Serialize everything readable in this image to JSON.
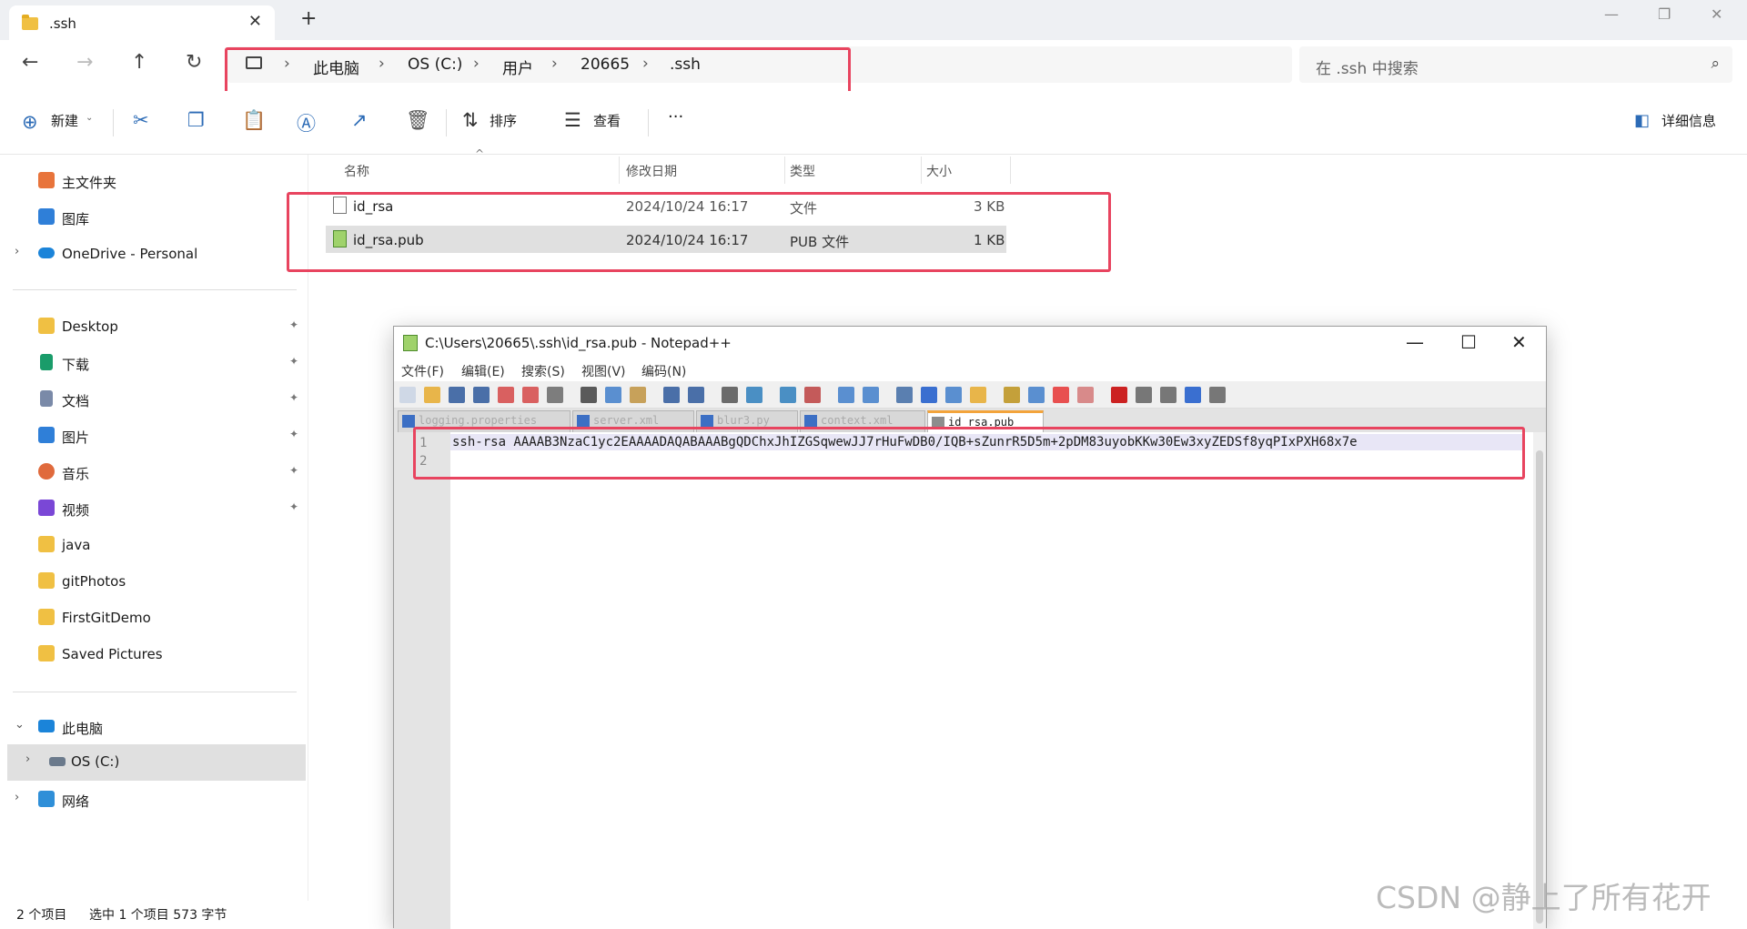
{
  "explorer": {
    "tab_title": ".ssh",
    "tab_close": "✕",
    "new_tab": "+",
    "window_buttons": {
      "minimize": "—",
      "maximize": "❐",
      "close": "✕"
    },
    "nav": {
      "back": "←",
      "forward": "→",
      "up": "↑",
      "refresh": "↻"
    },
    "breadcrumb": [
      "此电脑",
      "OS (C:)",
      "用户",
      "20665",
      ".ssh"
    ],
    "breadcrumb_sep": "›",
    "search_placeholder": "在 .ssh 中搜索",
    "toolbar": {
      "new_label": "新建",
      "sort_label": "排序",
      "view_label": "查看",
      "more_label": "···",
      "details_label": "详细信息"
    },
    "sidebar": {
      "quick": [
        {
          "label": "主文件夹",
          "icon": "home-icon",
          "color": "#e8743b"
        },
        {
          "label": "图库",
          "icon": "gallery-icon",
          "color": "#2f7fd8"
        },
        {
          "label": "OneDrive - Personal",
          "icon": "onedrive-icon",
          "color": "#1b84d9"
        }
      ],
      "pinned": [
        {
          "label": "Desktop",
          "icon": "folder-icon",
          "color": "#f0c043",
          "pinned": true
        },
        {
          "label": "下载",
          "icon": "download-icon",
          "color": "#1a9c6a",
          "pinned": true
        },
        {
          "label": "文档",
          "icon": "documents-icon",
          "color": "#7a8aa8",
          "pinned": true
        },
        {
          "label": "图片",
          "icon": "pictures-icon",
          "color": "#2f7fd8",
          "pinned": true
        },
        {
          "label": "音乐",
          "icon": "music-icon",
          "color": "#e06a3c",
          "pinned": true
        },
        {
          "label": "视频",
          "icon": "videos-icon",
          "color": "#7a47d6",
          "pinned": true
        },
        {
          "label": "java",
          "icon": "folder-icon",
          "color": "#f0c043",
          "pinned": false
        },
        {
          "label": "gitPhotos",
          "icon": "folder-icon",
          "color": "#f0c043",
          "pinned": false
        },
        {
          "label": "FirstGitDemo",
          "icon": "folder-icon",
          "color": "#f0c043",
          "pinned": false
        },
        {
          "label": "Saved Pictures",
          "icon": "folder-icon",
          "color": "#f0c043",
          "pinned": false
        }
      ],
      "this_pc": "此电脑",
      "drive": "OS (C:)",
      "network": "网络",
      "pin_glyph": "📌"
    },
    "columns": {
      "name": "名称",
      "modified": "修改日期",
      "type": "类型",
      "size": "大小"
    },
    "files": [
      {
        "name": "id_rsa",
        "modified": "2024/10/24 16:17",
        "type": "文件",
        "size": "3 KB",
        "selected": false
      },
      {
        "name": "id_rsa.pub",
        "modified": "2024/10/24 16:17",
        "type": "PUB 文件",
        "size": "1 KB",
        "selected": true
      }
    ],
    "status": {
      "count": "2 个项目",
      "selection": "选中 1 个项目  573 字节"
    }
  },
  "notepad": {
    "title": "C:\\Users\\20665\\.ssh\\id_rsa.pub - Notepad++",
    "menu": [
      "文件(F)",
      "编辑(E)",
      "搜索(S)",
      "视图(V)",
      "编码(N)"
    ],
    "tabs": [
      "logging.properties",
      "server.xml",
      "blur3.py",
      "context.xml",
      "id_rsa.pub"
    ],
    "active_tab": 4,
    "lines": [
      "1",
      "2"
    ],
    "line1": "ssh-rsa AAAAB3NzaC1yc2EAAAADAQABAAABgQDChxJhIZGSqwewJJ7rHuFwDB0/IQB+sZunrR5D5m+2pDM83uyobKKw30Ew3xyZEDSf8yqPIxPXH68x7e"
  },
  "watermark": "CSDN @静上了所有花开",
  "accent_highlight": "#e8445f"
}
